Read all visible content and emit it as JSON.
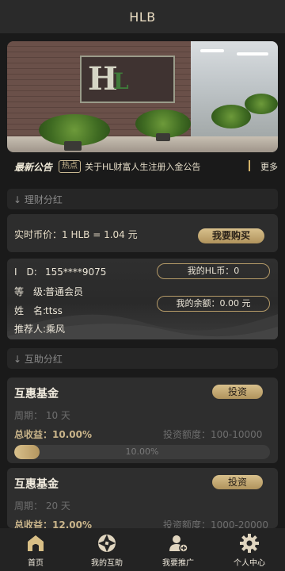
{
  "app": {
    "title": "HLB"
  },
  "notice": {
    "title": "最新公告",
    "tag": "热点",
    "text": "关于HL财富人生注册入金公告",
    "more": "更多"
  },
  "sections": {
    "finance": "↓ 理财分红",
    "mutual": "↓ 互助分红"
  },
  "price": {
    "label": "实时币价：1 HLB = 1.04 元",
    "buy_label": "我要购买"
  },
  "user": {
    "id_key": "I　D:",
    "id_value": "155****9075",
    "level_key": "等　级:",
    "level_value": "普通会员",
    "name_key": "姓　名:",
    "name_value": "ttss",
    "referrer_key": "推荐人:",
    "referrer_value": "乘风",
    "hl_coin": "我的HL币：0",
    "balance": "我的余额：0.00 元"
  },
  "funds": [
    {
      "name": "互惠基金",
      "invest_label": "投资",
      "period": "周期：  10 天",
      "income": "总收益：10.00%",
      "quota": "投资额度：100-10000",
      "progress_label": "10.00%",
      "progress": 0.1
    },
    {
      "name": "互惠基金",
      "invest_label": "投资",
      "period": "周期：  20 天",
      "income": "总收益：12.00%",
      "quota": "投资额度：1000-20000",
      "progress_label": "",
      "progress": 0
    }
  ],
  "tabs": [
    {
      "label": "首页",
      "icon": "home-icon"
    },
    {
      "label": "我的互助",
      "icon": "aperture-icon"
    },
    {
      "label": "我要推广",
      "icon": "add-user-icon"
    },
    {
      "label": "个人中心",
      "icon": "gear-icon"
    }
  ],
  "colors": {
    "accent": "#c9b48a",
    "background": "#1a1a1a",
    "card": "#2e2e2e"
  }
}
